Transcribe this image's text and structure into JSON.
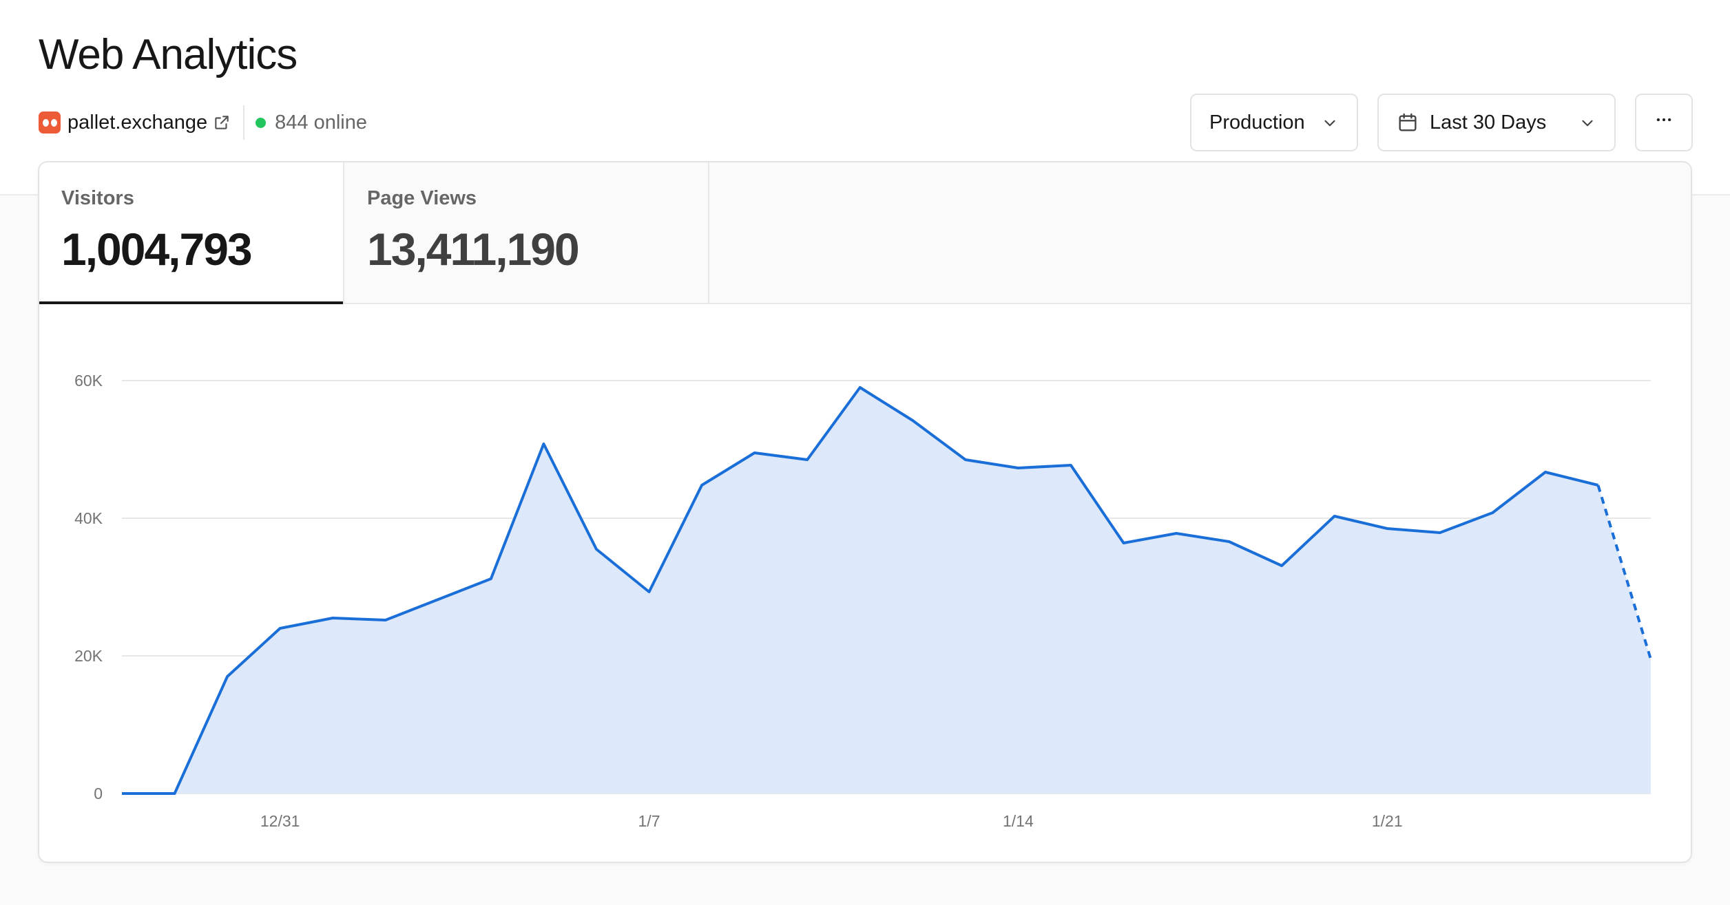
{
  "header": {
    "title": "Web Analytics",
    "site": "pallet.exchange",
    "online": "844 online"
  },
  "controls": {
    "environment": "Production",
    "date_range": "Last 30 Days",
    "more": "···"
  },
  "tabs": [
    {
      "label": "Visitors",
      "value": "1,004,793",
      "active": true
    },
    {
      "label": "Page Views",
      "value": "13,411,190",
      "active": false
    }
  ],
  "colors": {
    "accent_line": "#1a6ed8",
    "area_fill": "#dde8fb",
    "favicon": "#ec5b35",
    "online": "#22c55e"
  },
  "chart_data": {
    "type": "area",
    "series": [
      {
        "values": [
          0,
          0,
          17000,
          24000,
          25500,
          25200,
          28200,
          31200,
          50800,
          35500,
          29300,
          44800,
          49500,
          48500,
          59000,
          54200,
          48500,
          47300,
          47700,
          36400,
          37800,
          36600,
          33100,
          40300,
          38500,
          37900,
          40800,
          46700,
          44800,
          19500
        ]
      }
    ],
    "x_tick_labels": [
      "12/31",
      "1/7",
      "1/14",
      "1/21"
    ],
    "x_tick_indices": [
      3,
      10,
      17,
      24
    ],
    "y_ticks": [
      0,
      20000,
      40000,
      60000
    ],
    "y_tick_labels": [
      "0",
      "20K",
      "40K",
      "60K"
    ],
    "ylim": [
      0,
      60000
    ],
    "grid": true,
    "partial_last_point": true
  }
}
